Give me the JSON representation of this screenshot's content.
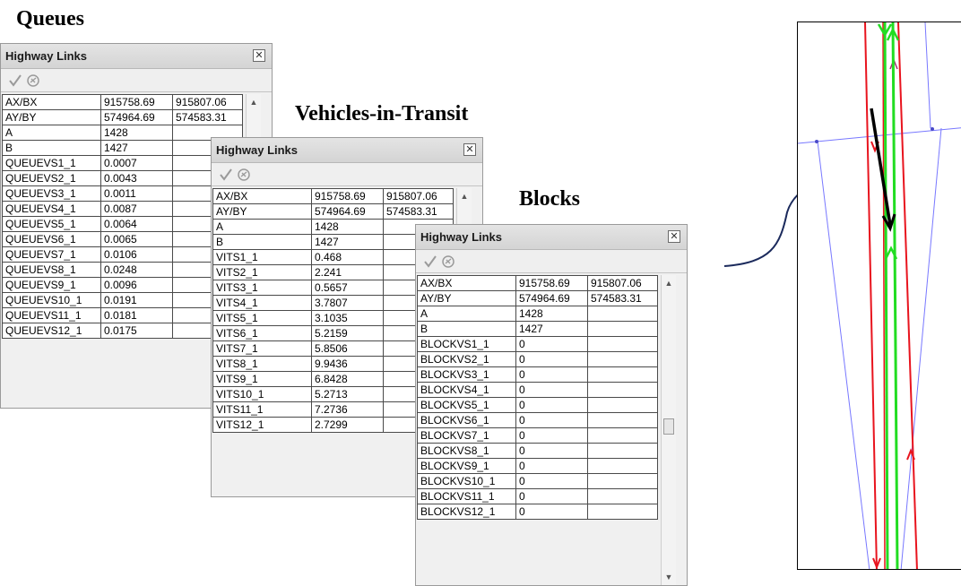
{
  "headings": {
    "queues": "Queues",
    "vehicles_in_transit": "Vehicles-in-Transit",
    "blocks": "Blocks"
  },
  "panels": [
    {
      "title": "Highway Links",
      "close_glyph": "✕",
      "toolbar_icons": [
        "checkmark-icon",
        "link-icon"
      ],
      "rows": [
        [
          "AX/BX",
          "915758.69",
          "915807.06"
        ],
        [
          "AY/BY",
          "574964.69",
          "574583.31"
        ],
        [
          "A",
          "1428",
          ""
        ],
        [
          "B",
          "1427",
          ""
        ],
        [
          "QUEUEVS1_1",
          "0.0007",
          ""
        ],
        [
          "QUEUEVS2_1",
          "0.0043",
          ""
        ],
        [
          "QUEUEVS3_1",
          "0.0011",
          ""
        ],
        [
          "QUEUEVS4_1",
          "0.0087",
          ""
        ],
        [
          "QUEUEVS5_1",
          "0.0064",
          ""
        ],
        [
          "QUEUEVS6_1",
          "0.0065",
          ""
        ],
        [
          "QUEUEVS7_1",
          "0.0106",
          ""
        ],
        [
          "QUEUEVS8_1",
          "0.0248",
          ""
        ],
        [
          "QUEUEVS9_1",
          "0.0096",
          ""
        ],
        [
          "QUEUEVS10_1",
          "0.0191",
          ""
        ],
        [
          "QUEUEVS11_1",
          "0.0181",
          ""
        ],
        [
          "QUEUEVS12_1",
          "0.0175",
          ""
        ]
      ]
    },
    {
      "title": "Highway Links",
      "close_glyph": "✕",
      "toolbar_icons": [
        "checkmark-icon",
        "link-icon"
      ],
      "rows": [
        [
          "AX/BX",
          "915758.69",
          "915807.06"
        ],
        [
          "AY/BY",
          "574964.69",
          "574583.31"
        ],
        [
          "A",
          "1428",
          ""
        ],
        [
          "B",
          "1427",
          ""
        ],
        [
          "VITS1_1",
          "0.468",
          ""
        ],
        [
          "VITS2_1",
          "2.241",
          ""
        ],
        [
          "VITS3_1",
          "0.5657",
          ""
        ],
        [
          "VITS4_1",
          "3.7807",
          ""
        ],
        [
          "VITS5_1",
          "3.1035",
          ""
        ],
        [
          "VITS6_1",
          "5.2159",
          ""
        ],
        [
          "VITS7_1",
          "5.8506",
          ""
        ],
        [
          "VITS8_1",
          "9.9436",
          ""
        ],
        [
          "VITS9_1",
          "6.8428",
          ""
        ],
        [
          "VITS10_1",
          "5.2713",
          ""
        ],
        [
          "VITS11_1",
          "7.2736",
          ""
        ],
        [
          "VITS12_1",
          "2.7299",
          ""
        ]
      ]
    },
    {
      "title": "Highway Links",
      "close_glyph": "✕",
      "toolbar_icons": [
        "checkmark-icon",
        "link-icon"
      ],
      "rows": [
        [
          "AX/BX",
          "915758.69",
          "915807.06"
        ],
        [
          "AY/BY",
          "574964.69",
          "574583.31"
        ],
        [
          "A",
          "1428",
          ""
        ],
        [
          "B",
          "1427",
          ""
        ],
        [
          "BLOCKVS1_1",
          "0",
          ""
        ],
        [
          "BLOCKVS2_1",
          "0",
          ""
        ],
        [
          "BLOCKVS3_1",
          "0",
          ""
        ],
        [
          "BLOCKVS4_1",
          "0",
          ""
        ],
        [
          "BLOCKVS5_1",
          "0",
          ""
        ],
        [
          "BLOCKVS6_1",
          "0",
          ""
        ],
        [
          "BLOCKVS7_1",
          "0",
          ""
        ],
        [
          "BLOCKVS8_1",
          "0",
          ""
        ],
        [
          "BLOCKVS9_1",
          "0",
          ""
        ],
        [
          "BLOCKVS10_1",
          "0",
          ""
        ],
        [
          "BLOCKVS11_1",
          "0",
          ""
        ],
        [
          "BLOCKVS12_1",
          "0",
          ""
        ]
      ]
    }
  ],
  "map": {
    "link_colors": {
      "red": "#e8141e",
      "green": "#22dd22",
      "blue": "#7878ff",
      "selected": "#000000",
      "callout": "#1b2a5c"
    }
  }
}
